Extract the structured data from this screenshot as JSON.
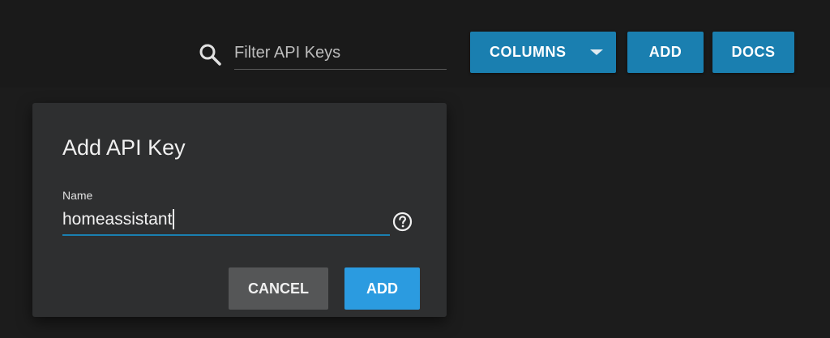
{
  "toolbar": {
    "search_placeholder": "Filter API Keys",
    "search_icon": "search-icon",
    "columns_label": "COLUMNS",
    "add_label": "ADD",
    "docs_label": "DOCS"
  },
  "dialog": {
    "title": "Add API Key",
    "name_label": "Name",
    "name_value": "homeassistant",
    "help_icon": "help-circle-icon",
    "cancel_label": "CANCEL",
    "add_label": "ADD"
  },
  "colors": {
    "accent": "#1a7fb0",
    "dialog_add": "#2b9be0",
    "background": "#1c1c1c",
    "dialog_bg": "#2e2f30"
  }
}
